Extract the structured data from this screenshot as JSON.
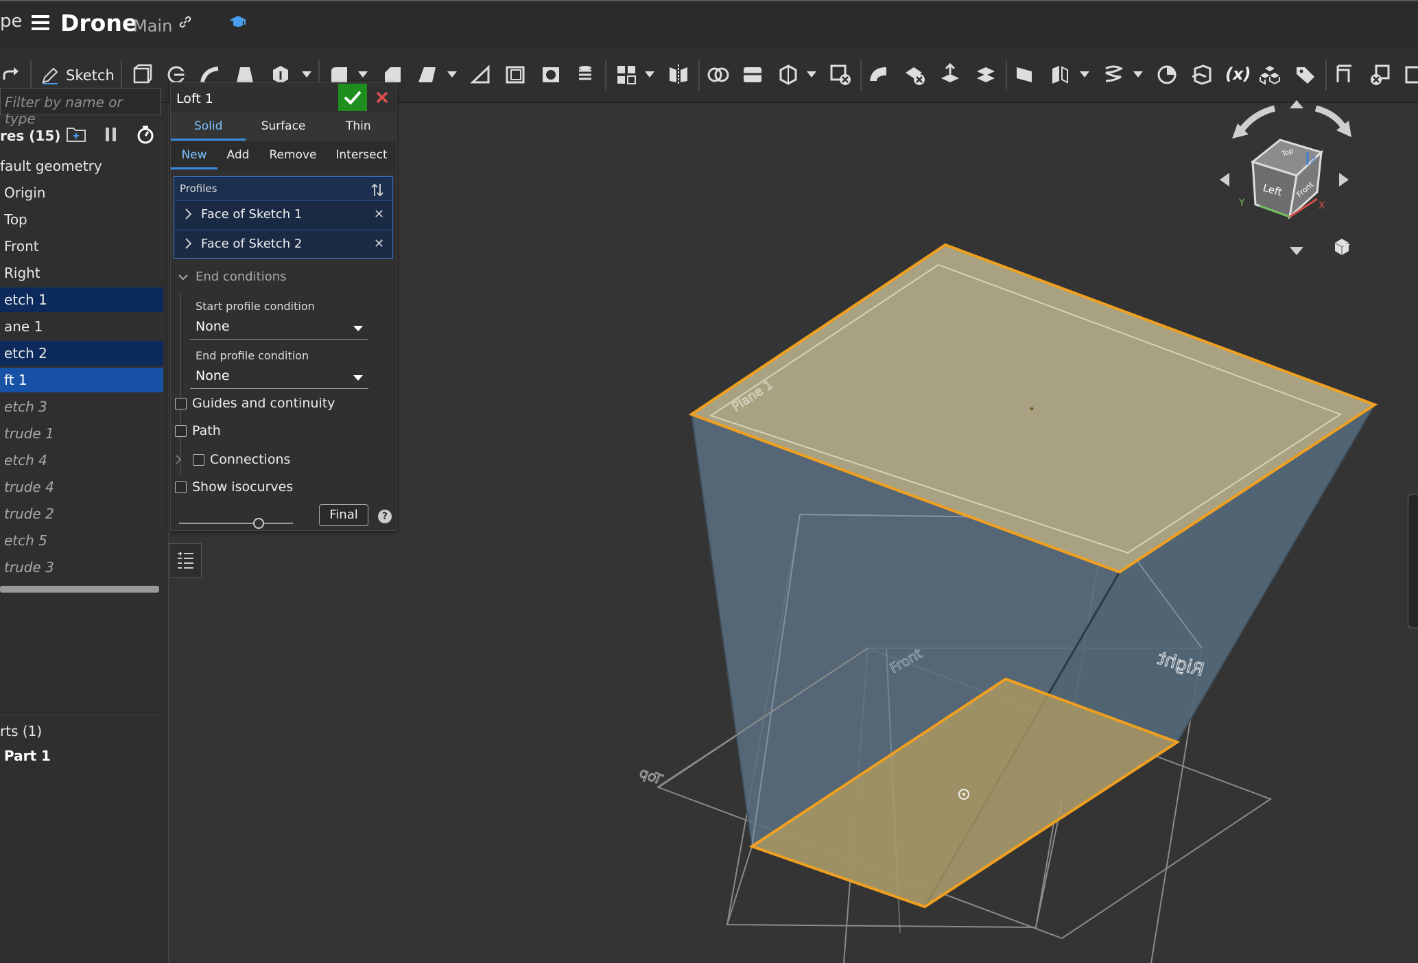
{
  "titlebar": {
    "crop_text": "pe",
    "document_name": "Drone",
    "branch": "Main"
  },
  "toolbar": {
    "sketch_label": "Sketch",
    "variable_label": "(x)"
  },
  "tree": {
    "filter_placeholder": "Filter by name or type",
    "features_header": "res (15)",
    "items": [
      {
        "label": "fault geometry",
        "state": "normal"
      },
      {
        "label": "Origin",
        "state": "normal"
      },
      {
        "label": "Top",
        "state": "normal"
      },
      {
        "label": "Front",
        "state": "normal"
      },
      {
        "label": "Right",
        "state": "normal"
      },
      {
        "label": "etch 1",
        "state": "selected"
      },
      {
        "label": "ane 1",
        "state": "normal"
      },
      {
        "label": "etch 2",
        "state": "selected"
      },
      {
        "label": "ft 1",
        "state": "active"
      },
      {
        "label": "etch 3",
        "state": "rolled"
      },
      {
        "label": "trude 1",
        "state": "rolled"
      },
      {
        "label": "etch 4",
        "state": "rolled"
      },
      {
        "label": "trude 4",
        "state": "rolled"
      },
      {
        "label": "trude 2",
        "state": "rolled"
      },
      {
        "label": "etch 5",
        "state": "rolled"
      },
      {
        "label": "trude 3",
        "state": "rolled"
      }
    ],
    "parts_header": "rts (1)",
    "part_name": "Part 1"
  },
  "dialog": {
    "title": "Loft 1",
    "body_tabs": [
      {
        "label": "Solid",
        "active": true
      },
      {
        "label": "Surface",
        "active": false
      },
      {
        "label": "Thin",
        "active": false
      }
    ],
    "op_tabs": [
      {
        "label": "New",
        "active": true
      },
      {
        "label": "Add",
        "active": false
      },
      {
        "label": "Remove",
        "active": false
      },
      {
        "label": "Intersect",
        "active": false
      }
    ],
    "profiles_label": "Profiles",
    "profiles": [
      "Face of Sketch 1",
      "Face of Sketch 2"
    ],
    "end_conditions_label": "End conditions",
    "start_condition_label": "Start profile condition",
    "start_condition_value": "None",
    "end_condition_label": "End profile condition",
    "end_condition_value": "None",
    "guides_label": "Guides and continuity",
    "path_label": "Path",
    "connections_label": "Connections",
    "isocurves_label": "Show isocurves",
    "final_label": "Final",
    "help_label": "?"
  },
  "viewport": {
    "plane_labels": {
      "plane1": "Plane 1",
      "front": "Front",
      "right": "Right",
      "top": "Top"
    },
    "cube_labels": {
      "left": "Left",
      "front": "Front",
      "top": "Top"
    },
    "axis_labels": {
      "x": "X",
      "y": "Y",
      "z": "Z"
    },
    "highlight_color": "#f0a020",
    "face_color": "#a8a283",
    "side_color": "#5a6e80"
  }
}
